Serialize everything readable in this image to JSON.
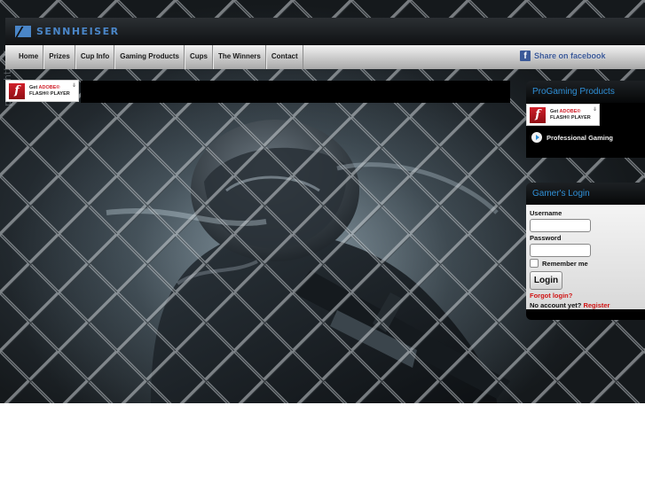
{
  "brand": {
    "logo_text": "SENNHEISER",
    "accent": "#4a86c8"
  },
  "watermark": "pro - http://poor...",
  "nav": {
    "items": [
      {
        "label": "Home"
      },
      {
        "label": "Prizes"
      },
      {
        "label": "Cup Info"
      },
      {
        "label": "Gaming Products"
      },
      {
        "label": "Cups"
      },
      {
        "label": "The Winners"
      },
      {
        "label": "Contact"
      }
    ],
    "facebook_share": "Share on facebook"
  },
  "flash": {
    "get": "Get",
    "adobe": "ADOBE®",
    "player": "FLASH® PLAYER"
  },
  "sidebar": {
    "progaming": {
      "title": "ProGaming Products",
      "link": "Professional Gaming"
    },
    "login": {
      "title": "Gamer's Login",
      "username_label": "Username",
      "password_label": "Password",
      "remember_label": "Remember me",
      "button_label": "Login",
      "forgot_link": "Forgot login?",
      "no_account": "No account yet?",
      "register_link": "Register"
    }
  },
  "colors": {
    "link_red": "#d11515",
    "header_blue": "#2f8fd6",
    "facebook_blue": "#3b5998"
  }
}
